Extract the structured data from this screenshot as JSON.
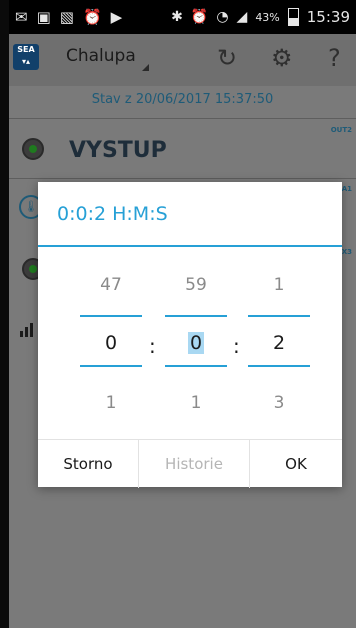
{
  "status_bar": {
    "battery": "43%",
    "time": "15:39"
  },
  "action_bar": {
    "title": "Chalupa",
    "logo_text": "SEA",
    "help": "?"
  },
  "background": {
    "stav": "Stav z 20/06/2017 15:37:50",
    "vystup": "VYSTUP",
    "tag_out2": "OUT2",
    "tag_a1": "A1",
    "tag_x3": "X3"
  },
  "dialog": {
    "title": "0:0:2 H:M:S",
    "hours": {
      "prev": "47",
      "value": "0",
      "next": "1"
    },
    "minutes": {
      "prev": "59",
      "value": "0",
      "next": "1"
    },
    "seconds": {
      "prev": "1",
      "value": "2",
      "next": "3"
    },
    "separator": ":",
    "buttons": {
      "cancel": "Storno",
      "history": "Historie",
      "ok": "OK"
    }
  },
  "colors": {
    "accent": "#26a0d6",
    "dim_overlay": "#7a7a7a",
    "status_bar": "#000000"
  }
}
